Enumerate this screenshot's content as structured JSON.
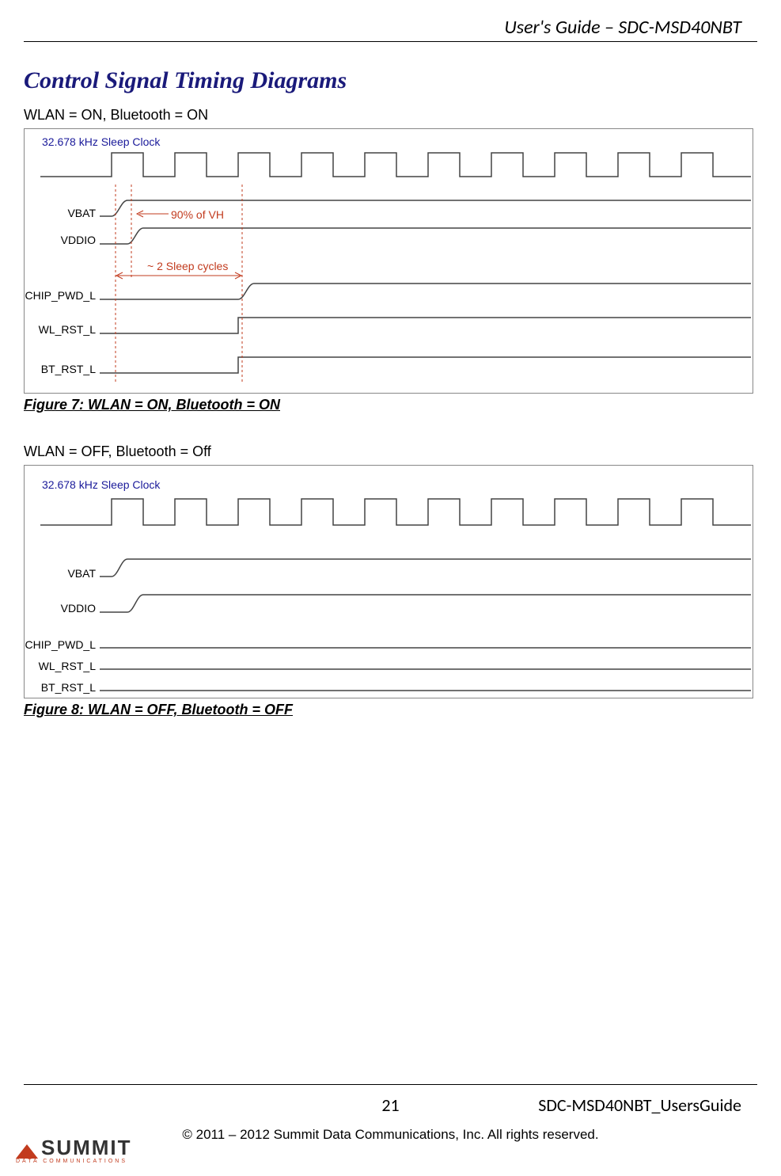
{
  "header": {
    "doc_title": "User's Guide – SDC-MSD40NBT"
  },
  "section": {
    "title": "Control Signal Timing Diagrams"
  },
  "figure7": {
    "title": "WLAN = ON, Bluetooth = ON",
    "caption": "Figure 7: WLAN = ON, Bluetooth = ON",
    "clock_label": "32.678 kHz Sleep Clock",
    "signals": {
      "vbat": "VBAT",
      "vddio": "VDDIO",
      "chip_pwd_l": "CHIP_PWD_L",
      "wl_rst_l": "WL_RST_L",
      "bt_rst_l": "BT_RST_L"
    },
    "annotations": {
      "ninety_pct": "90% of VH",
      "sleep_cycles": "~ 2 Sleep cycles"
    }
  },
  "figure8": {
    "title": "WLAN = OFF, Bluetooth = Off",
    "caption": "Figure 8: WLAN = OFF, Bluetooth = OFF",
    "clock_label": "32.678 kHz Sleep Clock",
    "signals": {
      "vbat": "VBAT",
      "vddio": "VDDIO",
      "chip_pwd_l": "CHIP_PWD_L",
      "wl_rst_l": "WL_RST_L",
      "bt_rst_l": "BT_RST_L"
    }
  },
  "footer": {
    "page": "21",
    "doc_id": "SDC-MSD40NBT_UsersGuide",
    "copyright": "© 2011 – 2012 Summit Data Communications, Inc. All rights reserved.",
    "logo_main": "SUMMIT",
    "logo_sub": "DATA COMMUNICATIONS"
  }
}
